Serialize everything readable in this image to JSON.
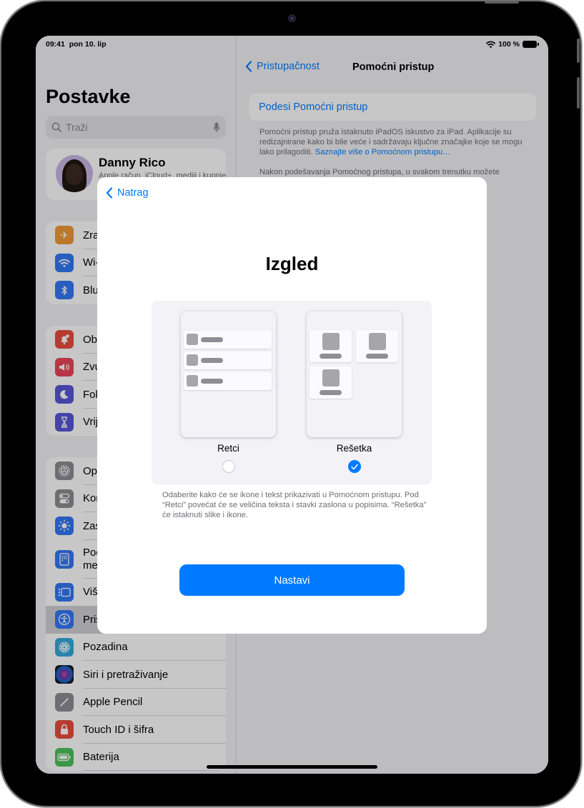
{
  "status_bar": {
    "time": "09:41",
    "date": "pon 10. lip",
    "battery": "100 %"
  },
  "sidebar": {
    "title": "Postavke",
    "search_placeholder": "Traži",
    "profile": {
      "name": "Danny Rico",
      "subtitle": "Apple račun, iCloud+, mediji i kupnje"
    },
    "groups": [
      [
        {
          "label": "Zrakoplovni način",
          "icon": "airplane-icon",
          "color": "#f09a37"
        },
        {
          "label": "Wi-Fi",
          "icon": "wifi-icon",
          "color": "#3478f6"
        },
        {
          "label": "Bluetooth",
          "icon": "bluetooth-icon",
          "color": "#3478f6"
        }
      ],
      [
        {
          "label": "Obavijesti",
          "icon": "notifications-icon",
          "color": "#eb4e3d"
        },
        {
          "label": "Zvukovi",
          "icon": "sounds-icon",
          "color": "#eb445a"
        },
        {
          "label": "Fokusiranje",
          "icon": "moon-icon",
          "color": "#5856d6"
        },
        {
          "label": "Vrijeme uporabe",
          "icon": "hourglass-icon",
          "color": "#5856d6"
        }
      ],
      [
        {
          "label": "Općenito",
          "icon": "gear-icon",
          "color": "#8e8e93"
        },
        {
          "label": "Kontrolni centar",
          "icon": "switches-icon",
          "color": "#8e8e93"
        },
        {
          "label": "Zaslon i svjetlina",
          "icon": "brightness-icon",
          "color": "#3478f6"
        },
        {
          "label": "Početni zaslon i međuaplikacijski rad",
          "icon": "home-screen-icon",
          "color": "#3478f6"
        },
        {
          "label": "Višezadaćnost i geste",
          "icon": "multitasking-icon",
          "color": "#3478f6"
        },
        {
          "label": "Pristupačnost",
          "icon": "accessibility-icon",
          "color": "#3478f6"
        },
        {
          "label": "Pozadina",
          "icon": "wallpaper-icon",
          "color": "#35aadc"
        },
        {
          "label": "Siri i pretraživanje",
          "icon": "siri-icon",
          "color": "#1c1c1e"
        },
        {
          "label": "Apple Pencil",
          "icon": "pencil-icon",
          "color": "#8e8e93"
        },
        {
          "label": "Touch ID i šifra",
          "icon": "lock-icon",
          "color": "#eb4e3d"
        },
        {
          "label": "Baterija",
          "icon": "battery-icon",
          "color": "#4cc25c"
        }
      ]
    ]
  },
  "detail": {
    "back_label": "Pristupačnost",
    "title": "Pomoćni pristup",
    "setup_label": "Podesi Pomoćni pristup",
    "footnote_1": "Pomoćni pristup pruža istaknuto iPadOS iskustvo za iPad. Aplikacije su redizajnirane kako bi bile veće i sadržavaju ključne značajke koje se mogu lako prilagoditi.",
    "footnote_link": "Saznajte više o Pomoćnom pristupu…",
    "footnote_2": "Nakon podešavanja Pomoćnog pristupa, u svakom trenutku možete"
  },
  "sheet": {
    "back_label": "Natrag",
    "title": "Izgled",
    "options": [
      {
        "label": "Retci",
        "selected": false
      },
      {
        "label": "Rešetka",
        "selected": true
      }
    ],
    "description": "Odaberite kako će se ikone i tekst prikazivati u Pomoćnom pristupu. Pod “Retci” povećat će se veličina teksta i stavki zaslona u popisima. “Rešetka” će istaknuti slike i ikone.",
    "continue_label": "Nastavi"
  },
  "colors": {
    "accent": "#007aff"
  }
}
